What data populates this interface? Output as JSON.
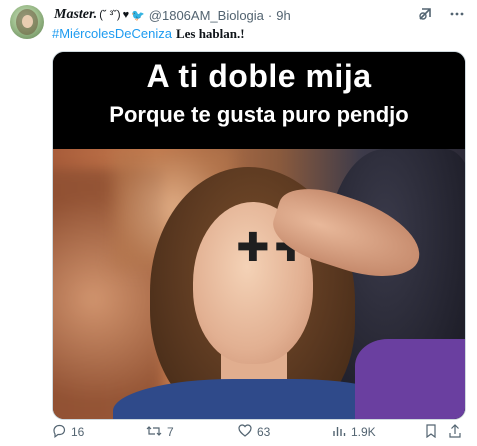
{
  "tweet": {
    "author": {
      "apple_glyph": "",
      "display_name": "Master.",
      "emoticon": "(˘ ³˘)",
      "heart": "♥",
      "bird": "🐦",
      "handle": "@1806AM_Biologia",
      "separator": "·",
      "time": "9h"
    },
    "header_icons": [
      "grok-icon",
      "more-icon"
    ],
    "text": {
      "hashtag": "#MiércolesDeCeniza",
      "rest": "Les hablan.!"
    },
    "media": {
      "caption_line1": "A ti doble mija",
      "caption_line2": "Porque te gusta puro pendjo",
      "cross1": "✚",
      "cross2": "✚"
    },
    "actions": {
      "replies": "16",
      "reposts": "7",
      "likes": "63",
      "views": "1.9K"
    }
  }
}
